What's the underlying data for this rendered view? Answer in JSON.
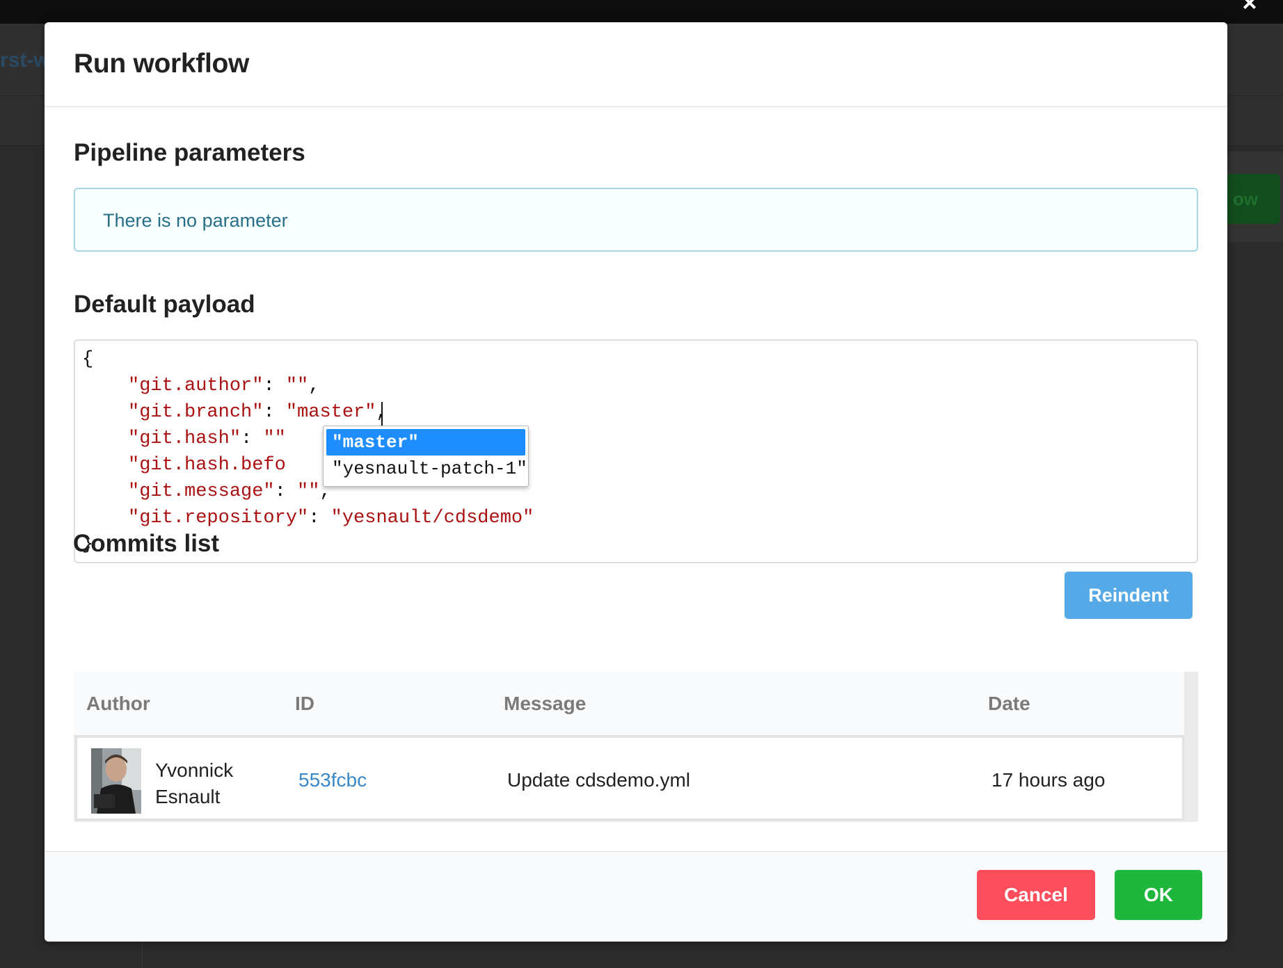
{
  "background": {
    "title_fragment": "rst-w",
    "button_fragment": "ow"
  },
  "close_icon": "×",
  "modal": {
    "title": "Run workflow",
    "pipeline_parameters": {
      "heading": "Pipeline parameters",
      "message": "There is no parameter"
    },
    "default_payload": {
      "heading": "Default payload",
      "open_brace": "{",
      "close_brace": "}",
      "lines": [
        {
          "key": "\"git.author\"",
          "sep": ": ",
          "value": "\"\"",
          "tail": ","
        },
        {
          "key": "\"git.branch\"",
          "sep": ": ",
          "value": "\"master\"",
          "tail": ","
        },
        {
          "key": "\"git.hash\"",
          "sep": ": ",
          "value": "\"\"",
          "tail": ""
        },
        {
          "key": "\"git.hash.befo",
          "sep": "",
          "value": "",
          "tail": ""
        },
        {
          "key": "\"git.message\"",
          "sep": ": ",
          "value": "\"\"",
          "tail": ","
        },
        {
          "key": "\"git.repository\"",
          "sep": ": ",
          "value": "\"yesnault/cdsdemo\"",
          "tail": ""
        }
      ],
      "autocomplete": [
        "\"master\"",
        "\"yesnault-patch-1\""
      ],
      "autocomplete_selected": "\"master\"",
      "reindent_label": "Reindent"
    },
    "commits": {
      "heading": "Commits list",
      "columns": [
        "Author",
        "ID",
        "Message",
        "Date"
      ],
      "rows": [
        {
          "author": "Yvonnick Esnault",
          "id": "553fcbc",
          "message": "Update cdsdemo.yml",
          "date": "17 hours ago"
        }
      ]
    },
    "footer": {
      "cancel_label": "Cancel",
      "ok_label": "OK"
    }
  },
  "colors": {
    "cancel": "#fb4d5c",
    "ok": "#1fb63c",
    "reindent": "#54a9e6",
    "link": "#3b88c6",
    "json_string": "#aa1111",
    "autocomplete_selected": "#1e8dff"
  }
}
